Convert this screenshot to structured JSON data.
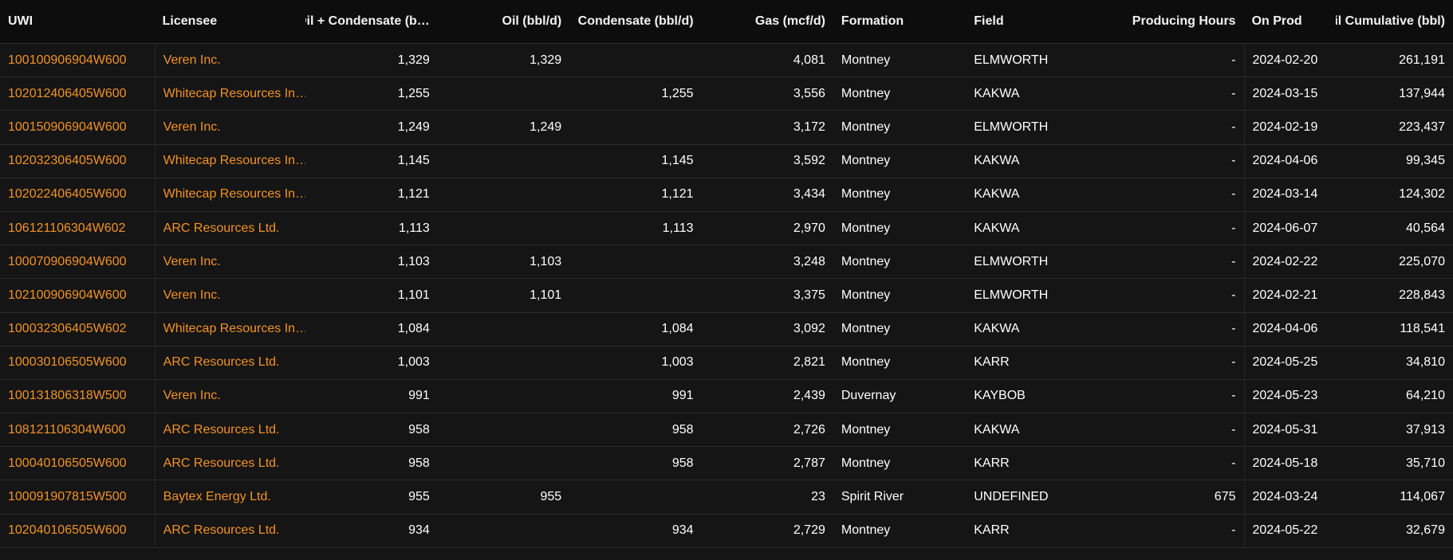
{
  "table": {
    "columns": [
      {
        "key": "uwi",
        "label": "UWI",
        "cls": "c-uwi",
        "align": "left",
        "link": true
      },
      {
        "key": "licensee",
        "label": "Licensee",
        "cls": "c-lic",
        "align": "left",
        "link": true
      },
      {
        "key": "oil_cond",
        "label": "Oil + Condensate (b…",
        "cls": "c-oc",
        "align": "right",
        "link": false
      },
      {
        "key": "oil",
        "label": "Oil (bbl/d)",
        "cls": "c-oil",
        "align": "right",
        "link": false
      },
      {
        "key": "condensate",
        "label": "Condensate (bbl/d)",
        "cls": "c-cond",
        "align": "right",
        "link": false
      },
      {
        "key": "gas",
        "label": "Gas (mcf/d)",
        "cls": "c-gas",
        "align": "right",
        "link": false
      },
      {
        "key": "formation",
        "label": "Formation",
        "cls": "c-form",
        "align": "left",
        "link": false
      },
      {
        "key": "field",
        "label": "Field",
        "cls": "c-field",
        "align": "left",
        "link": false
      },
      {
        "key": "producing_hours",
        "label": "Producing Hours",
        "cls": "c-ph",
        "align": "right",
        "link": false
      },
      {
        "key": "on_prod",
        "label": "On Prod",
        "cls": "c-onprod",
        "align": "left",
        "link": false
      },
      {
        "key": "oil_cumulative",
        "label": "Oil Cumulative (bbl)",
        "cls": "c-cum",
        "align": "right",
        "link": false
      }
    ],
    "rows": [
      {
        "uwi": "100100906904W600",
        "licensee": "Veren Inc.",
        "oil_cond": "1,329",
        "oil": "1,329",
        "condensate": "",
        "gas": "4,081",
        "formation": "Montney",
        "field": "ELMWORTH",
        "producing_hours": "-",
        "on_prod": "2024-02-20",
        "oil_cumulative": "261,191"
      },
      {
        "uwi": "102012406405W600",
        "licensee": "Whitecap Resources In…",
        "oil_cond": "1,255",
        "oil": "",
        "condensate": "1,255",
        "gas": "3,556",
        "formation": "Montney",
        "field": "KAKWA",
        "producing_hours": "-",
        "on_prod": "2024-03-15",
        "oil_cumulative": "137,944"
      },
      {
        "uwi": "100150906904W600",
        "licensee": "Veren Inc.",
        "oil_cond": "1,249",
        "oil": "1,249",
        "condensate": "",
        "gas": "3,172",
        "formation": "Montney",
        "field": "ELMWORTH",
        "producing_hours": "-",
        "on_prod": "2024-02-19",
        "oil_cumulative": "223,437"
      },
      {
        "uwi": "102032306405W600",
        "licensee": "Whitecap Resources In…",
        "oil_cond": "1,145",
        "oil": "",
        "condensate": "1,145",
        "gas": "3,592",
        "formation": "Montney",
        "field": "KAKWA",
        "producing_hours": "-",
        "on_prod": "2024-04-06",
        "oil_cumulative": "99,345"
      },
      {
        "uwi": "102022406405W600",
        "licensee": "Whitecap Resources In…",
        "oil_cond": "1,121",
        "oil": "",
        "condensate": "1,121",
        "gas": "3,434",
        "formation": "Montney",
        "field": "KAKWA",
        "producing_hours": "-",
        "on_prod": "2024-03-14",
        "oil_cumulative": "124,302"
      },
      {
        "uwi": "106121106304W602",
        "licensee": "ARC Resources Ltd.",
        "oil_cond": "1,113",
        "oil": "",
        "condensate": "1,113",
        "gas": "2,970",
        "formation": "Montney",
        "field": "KAKWA",
        "producing_hours": "-",
        "on_prod": "2024-06-07",
        "oil_cumulative": "40,564"
      },
      {
        "uwi": "100070906904W600",
        "licensee": "Veren Inc.",
        "oil_cond": "1,103",
        "oil": "1,103",
        "condensate": "",
        "gas": "3,248",
        "formation": "Montney",
        "field": "ELMWORTH",
        "producing_hours": "-",
        "on_prod": "2024-02-22",
        "oil_cumulative": "225,070"
      },
      {
        "uwi": "102100906904W600",
        "licensee": "Veren Inc.",
        "oil_cond": "1,101",
        "oil": "1,101",
        "condensate": "",
        "gas": "3,375",
        "formation": "Montney",
        "field": "ELMWORTH",
        "producing_hours": "-",
        "on_prod": "2024-02-21",
        "oil_cumulative": "228,843"
      },
      {
        "uwi": "100032306405W602",
        "licensee": "Whitecap Resources In…",
        "oil_cond": "1,084",
        "oil": "",
        "condensate": "1,084",
        "gas": "3,092",
        "formation": "Montney",
        "field": "KAKWA",
        "producing_hours": "-",
        "on_prod": "2024-04-06",
        "oil_cumulative": "118,541"
      },
      {
        "uwi": "100030106505W600",
        "licensee": "ARC Resources Ltd.",
        "oil_cond": "1,003",
        "oil": "",
        "condensate": "1,003",
        "gas": "2,821",
        "formation": "Montney",
        "field": "KARR",
        "producing_hours": "-",
        "on_prod": "2024-05-25",
        "oil_cumulative": "34,810"
      },
      {
        "uwi": "100131806318W500",
        "licensee": "Veren Inc.",
        "oil_cond": "991",
        "oil": "",
        "condensate": "991",
        "gas": "2,439",
        "formation": "Duvernay",
        "field": "KAYBOB",
        "producing_hours": "-",
        "on_prod": "2024-05-23",
        "oil_cumulative": "64,210"
      },
      {
        "uwi": "108121106304W600",
        "licensee": "ARC Resources Ltd.",
        "oil_cond": "958",
        "oil": "",
        "condensate": "958",
        "gas": "2,726",
        "formation": "Montney",
        "field": "KAKWA",
        "producing_hours": "-",
        "on_prod": "2024-05-31",
        "oil_cumulative": "37,913"
      },
      {
        "uwi": "100040106505W600",
        "licensee": "ARC Resources Ltd.",
        "oil_cond": "958",
        "oil": "",
        "condensate": "958",
        "gas": "2,787",
        "formation": "Montney",
        "field": "KARR",
        "producing_hours": "-",
        "on_prod": "2024-05-18",
        "oil_cumulative": "35,710"
      },
      {
        "uwi": "100091907815W500",
        "licensee": "Baytex Energy Ltd.",
        "oil_cond": "955",
        "oil": "955",
        "condensate": "",
        "gas": "23",
        "formation": "Spirit River",
        "field": "UNDEFINED",
        "producing_hours": "675",
        "on_prod": "2024-03-24",
        "oil_cumulative": "114,067"
      },
      {
        "uwi": "102040106505W600",
        "licensee": "ARC Resources Ltd.",
        "oil_cond": "934",
        "oil": "",
        "condensate": "934",
        "gas": "2,729",
        "formation": "Montney",
        "field": "KARR",
        "producing_hours": "-",
        "on_prod": "2024-05-22",
        "oil_cumulative": "32,679"
      }
    ]
  },
  "colors": {
    "background": "#151515",
    "header_background": "#0d0d0d",
    "link": "#f29224",
    "text": "#ffffff"
  }
}
